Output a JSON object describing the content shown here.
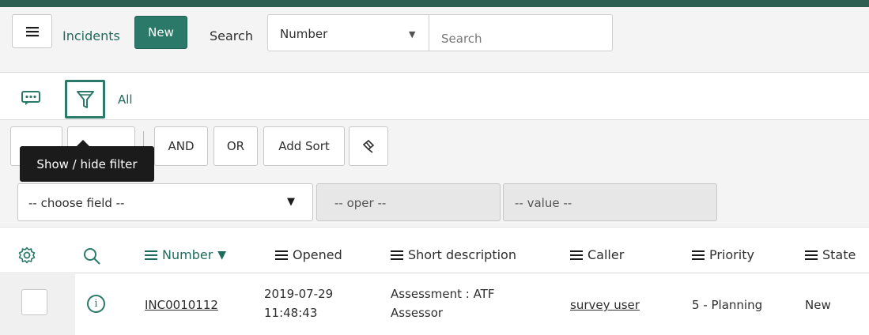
{
  "header": {
    "title": "Incidents",
    "new_label": "New",
    "search_label": "Search",
    "search_field": "Number",
    "search_placeholder": "Search"
  },
  "toolbar": {
    "all_label": "All"
  },
  "filter": {
    "and_label": "AND",
    "or_label": "OR",
    "add_sort_label": "Add Sort",
    "tooltip": "Show / hide filter",
    "field_placeholder": "-- choose field --",
    "oper_placeholder": "-- oper --",
    "value_placeholder": "-- value --"
  },
  "table": {
    "columns": [
      "Number",
      "Opened",
      "Short description",
      "Caller",
      "Priority",
      "State"
    ],
    "sorted_column": "Number",
    "rows": [
      {
        "number": "INC0010112",
        "opened_date": "2019-07-29",
        "opened_time": "11:48:43",
        "short_desc_1": "Assessment : ATF",
        "short_desc_2": "Assessor",
        "caller": "survey user",
        "priority": "5 - Planning",
        "state": "New"
      }
    ]
  },
  "colors": {
    "accent": "#2b7a69",
    "link": "#1f6b5e",
    "tooltip_bg": "#1b1b1b"
  },
  "icons": [
    "menu-icon",
    "comment-icon",
    "filter-icon",
    "gear-icon",
    "search-icon",
    "clear-sort-icon",
    "info-icon"
  ]
}
